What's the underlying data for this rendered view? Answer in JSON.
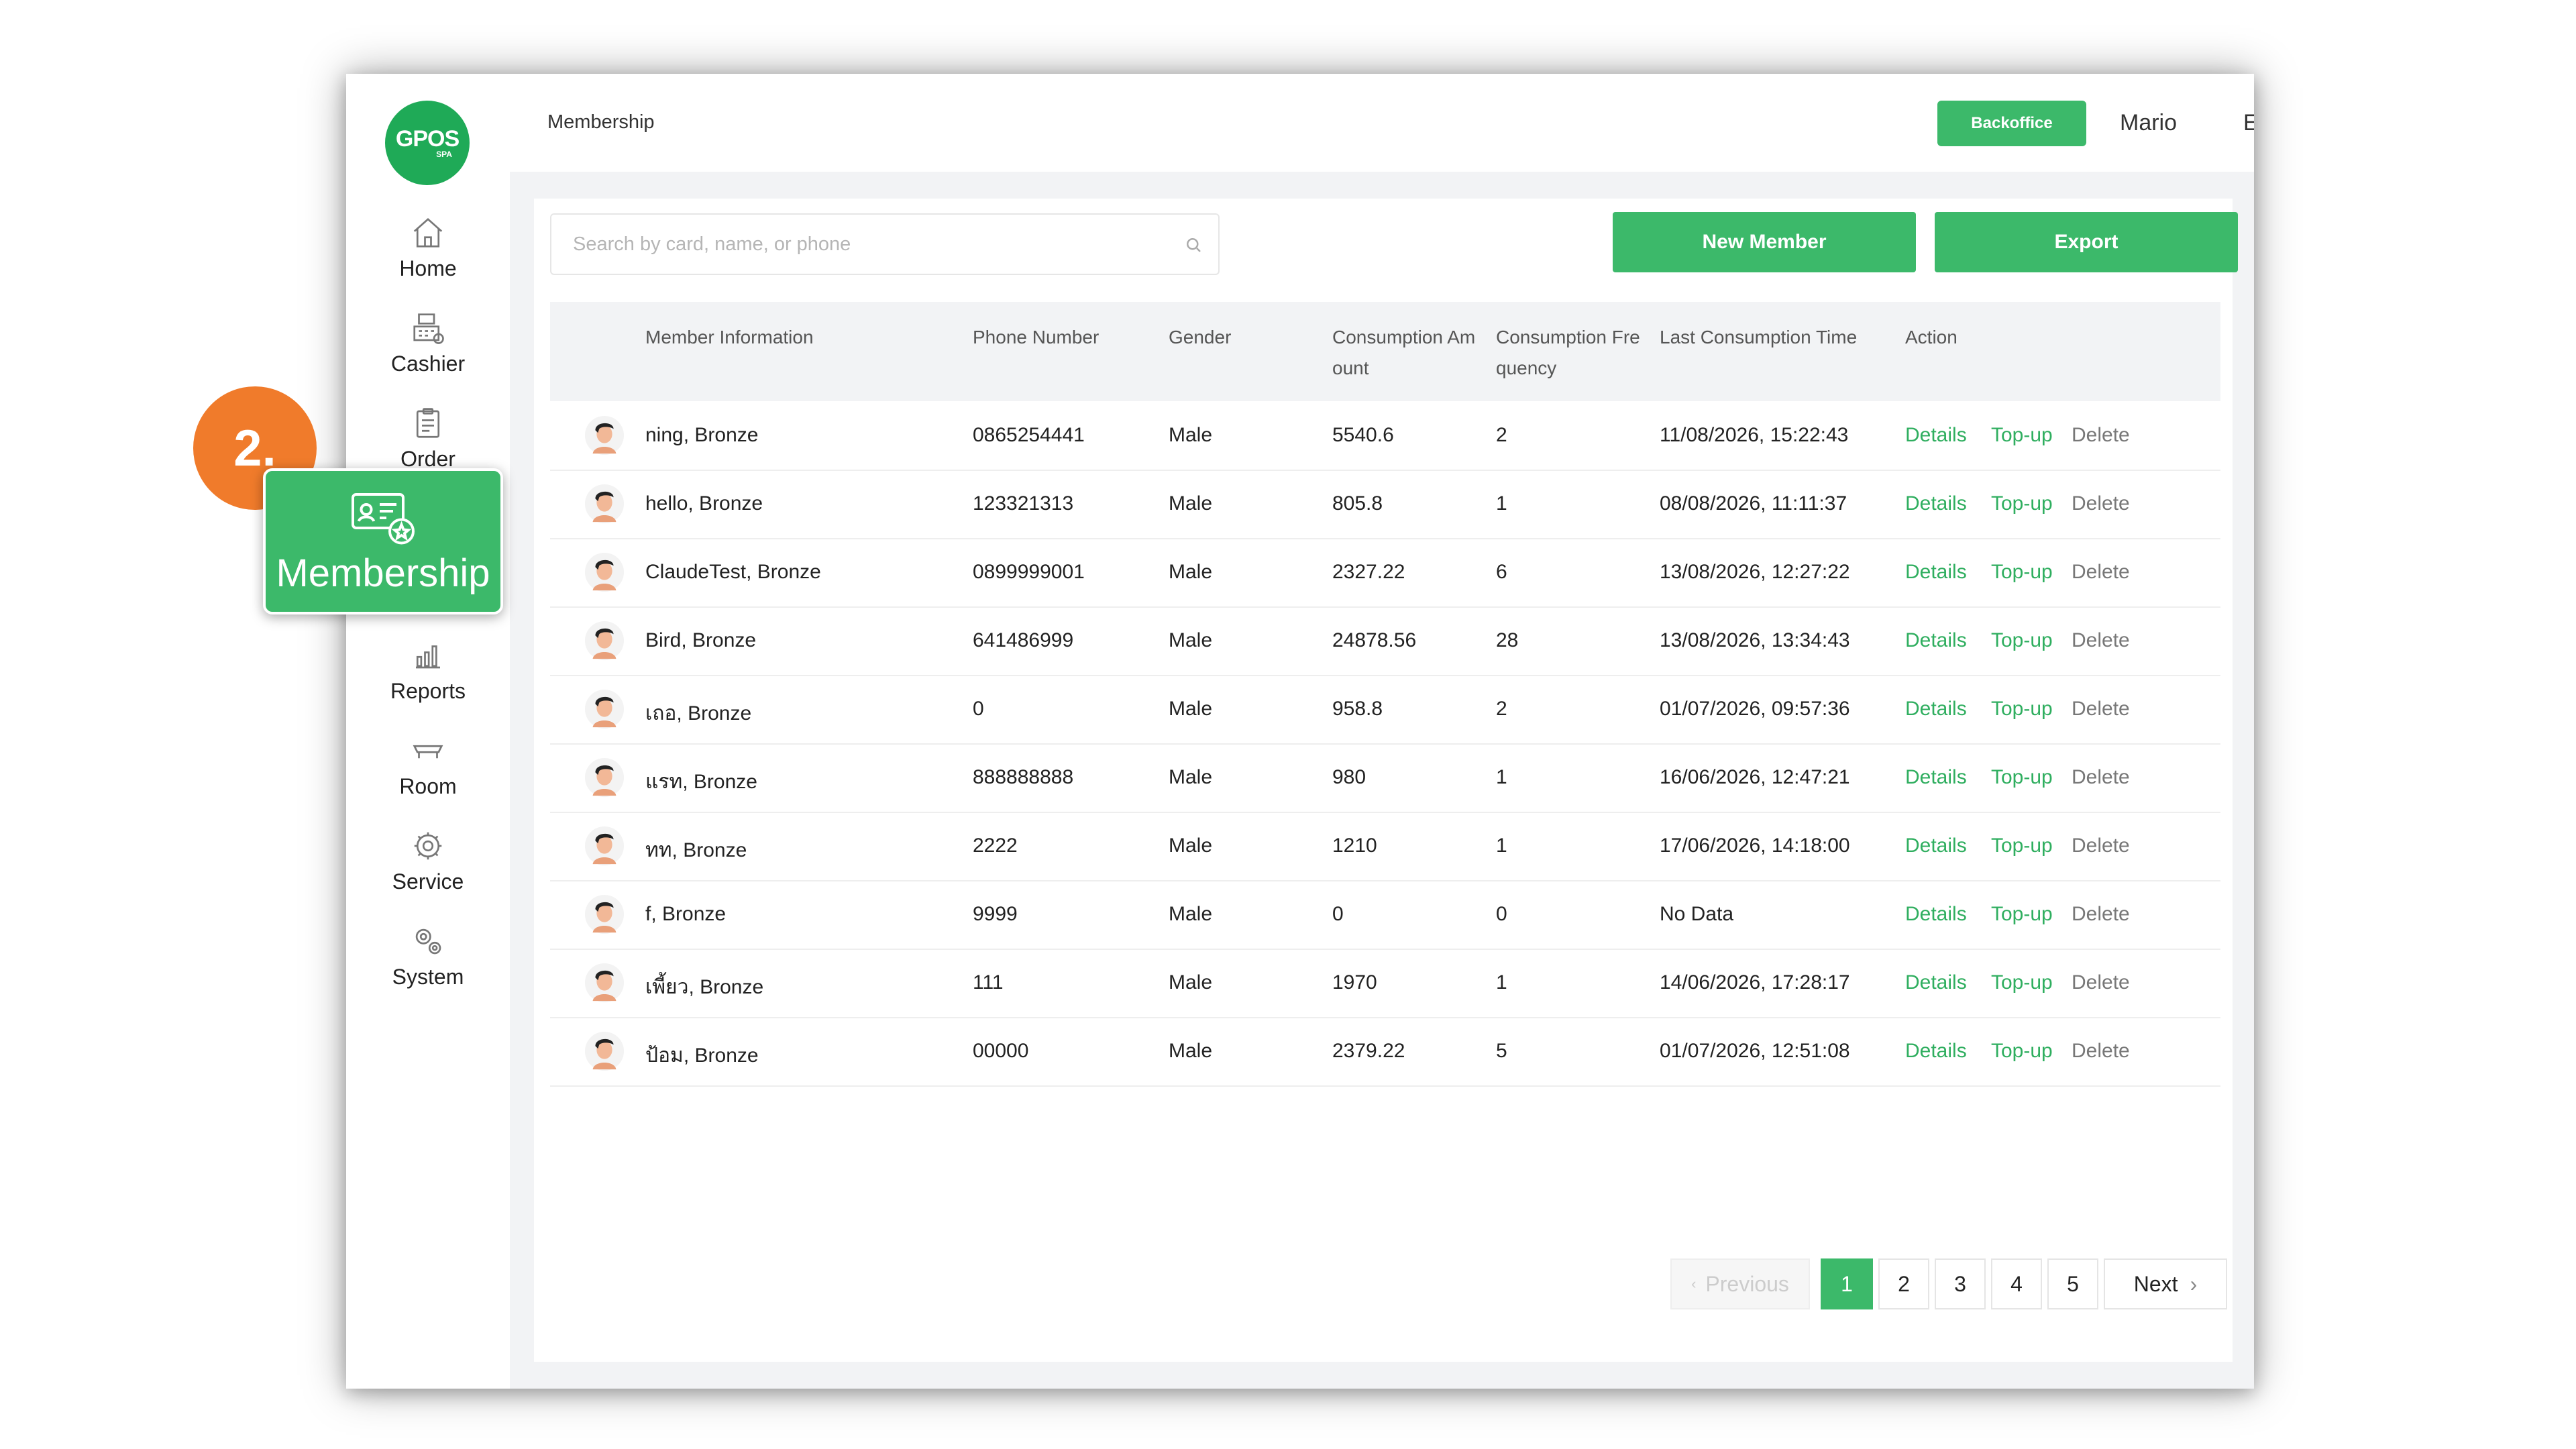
{
  "logo": {
    "main": "GPOS",
    "sub": "SPA"
  },
  "sidebar": {
    "items": [
      {
        "label": "Home",
        "icon": "home-icon"
      },
      {
        "label": "Cashier",
        "icon": "cashier-icon"
      },
      {
        "label": "Order",
        "icon": "order-icon"
      },
      {
        "label": "Membership",
        "icon": "membership-card-icon"
      },
      {
        "label": "Reports",
        "icon": "reports-icon"
      },
      {
        "label": "Room",
        "icon": "room-icon"
      },
      {
        "label": "Service",
        "icon": "service-icon"
      },
      {
        "label": "System",
        "icon": "system-gear-icon"
      }
    ]
  },
  "header": {
    "title": "Membership",
    "backoffice_label": "Backoffice",
    "user": "Mario",
    "language": "EN"
  },
  "toolbar": {
    "search_placeholder": "Search by card, name, or phone",
    "new_member_label": "New Member",
    "export_label": "Export"
  },
  "table": {
    "headers": {
      "member": "Member Information",
      "phone": "Phone Number",
      "gender": "Gender",
      "amount_1": "Consumption Am",
      "amount_2": "ount",
      "freq_1": "Consumption Fre",
      "freq_2": "quency",
      "last": "Last Consumption Time",
      "action": "Action"
    },
    "actions": {
      "details": "Details",
      "topup": "Top-up",
      "delete": "Delete"
    },
    "rows": [
      {
        "name": "ning, Bronze",
        "phone": "0865254441",
        "gender": "Male",
        "amount": "5540.6",
        "freq": "2",
        "last": "11/08/2026, 15:22:43"
      },
      {
        "name": "hello, Bronze",
        "phone": "123321313",
        "gender": "Male",
        "amount": "805.8",
        "freq": "1",
        "last": "08/08/2026, 11:11:37"
      },
      {
        "name": "ClaudeTest, Bronze",
        "phone": "0899999001",
        "gender": "Male",
        "amount": "2327.22",
        "freq": "6",
        "last": "13/08/2026, 12:27:22"
      },
      {
        "name": "Bird, Bronze",
        "phone": "641486999",
        "gender": "Male",
        "amount": "24878.56",
        "freq": "28",
        "last": "13/08/2026, 13:34:43"
      },
      {
        "name": "เถอ, Bronze",
        "phone": "0",
        "gender": "Male",
        "amount": "958.8",
        "freq": "2",
        "last": "01/07/2026, 09:57:36"
      },
      {
        "name": "แรท, Bronze",
        "phone": "888888888",
        "gender": "Male",
        "amount": "980",
        "freq": "1",
        "last": "16/06/2026, 12:47:21"
      },
      {
        "name": "ทท, Bronze",
        "phone": "2222",
        "gender": "Male",
        "amount": "1210",
        "freq": "1",
        "last": "17/06/2026, 14:18:00"
      },
      {
        "name": "f, Bronze",
        "phone": "9999",
        "gender": "Male",
        "amount": "0",
        "freq": "0",
        "last": "No Data"
      },
      {
        "name": "เพี้ยว, Bronze",
        "phone": "111",
        "gender": "Male",
        "amount": "1970",
        "freq": "1",
        "last": "14/06/2026, 17:28:17"
      },
      {
        "name": "ป้อม, Bronze",
        "phone": "00000",
        "gender": "Male",
        "amount": "2379.22",
        "freq": "5",
        "last": "01/07/2026, 12:51:08"
      }
    ]
  },
  "pagination": {
    "previous_label": "Previous",
    "next_label": "Next",
    "pages": [
      "1",
      "2",
      "3",
      "4",
      "5"
    ],
    "current": "1"
  },
  "overlay": {
    "step_label": "2.",
    "highlight_label": "Membership"
  },
  "colors": {
    "brand_green": "#3cb96a",
    "logo_green": "#1faa57",
    "step_orange": "#f07b2b"
  }
}
